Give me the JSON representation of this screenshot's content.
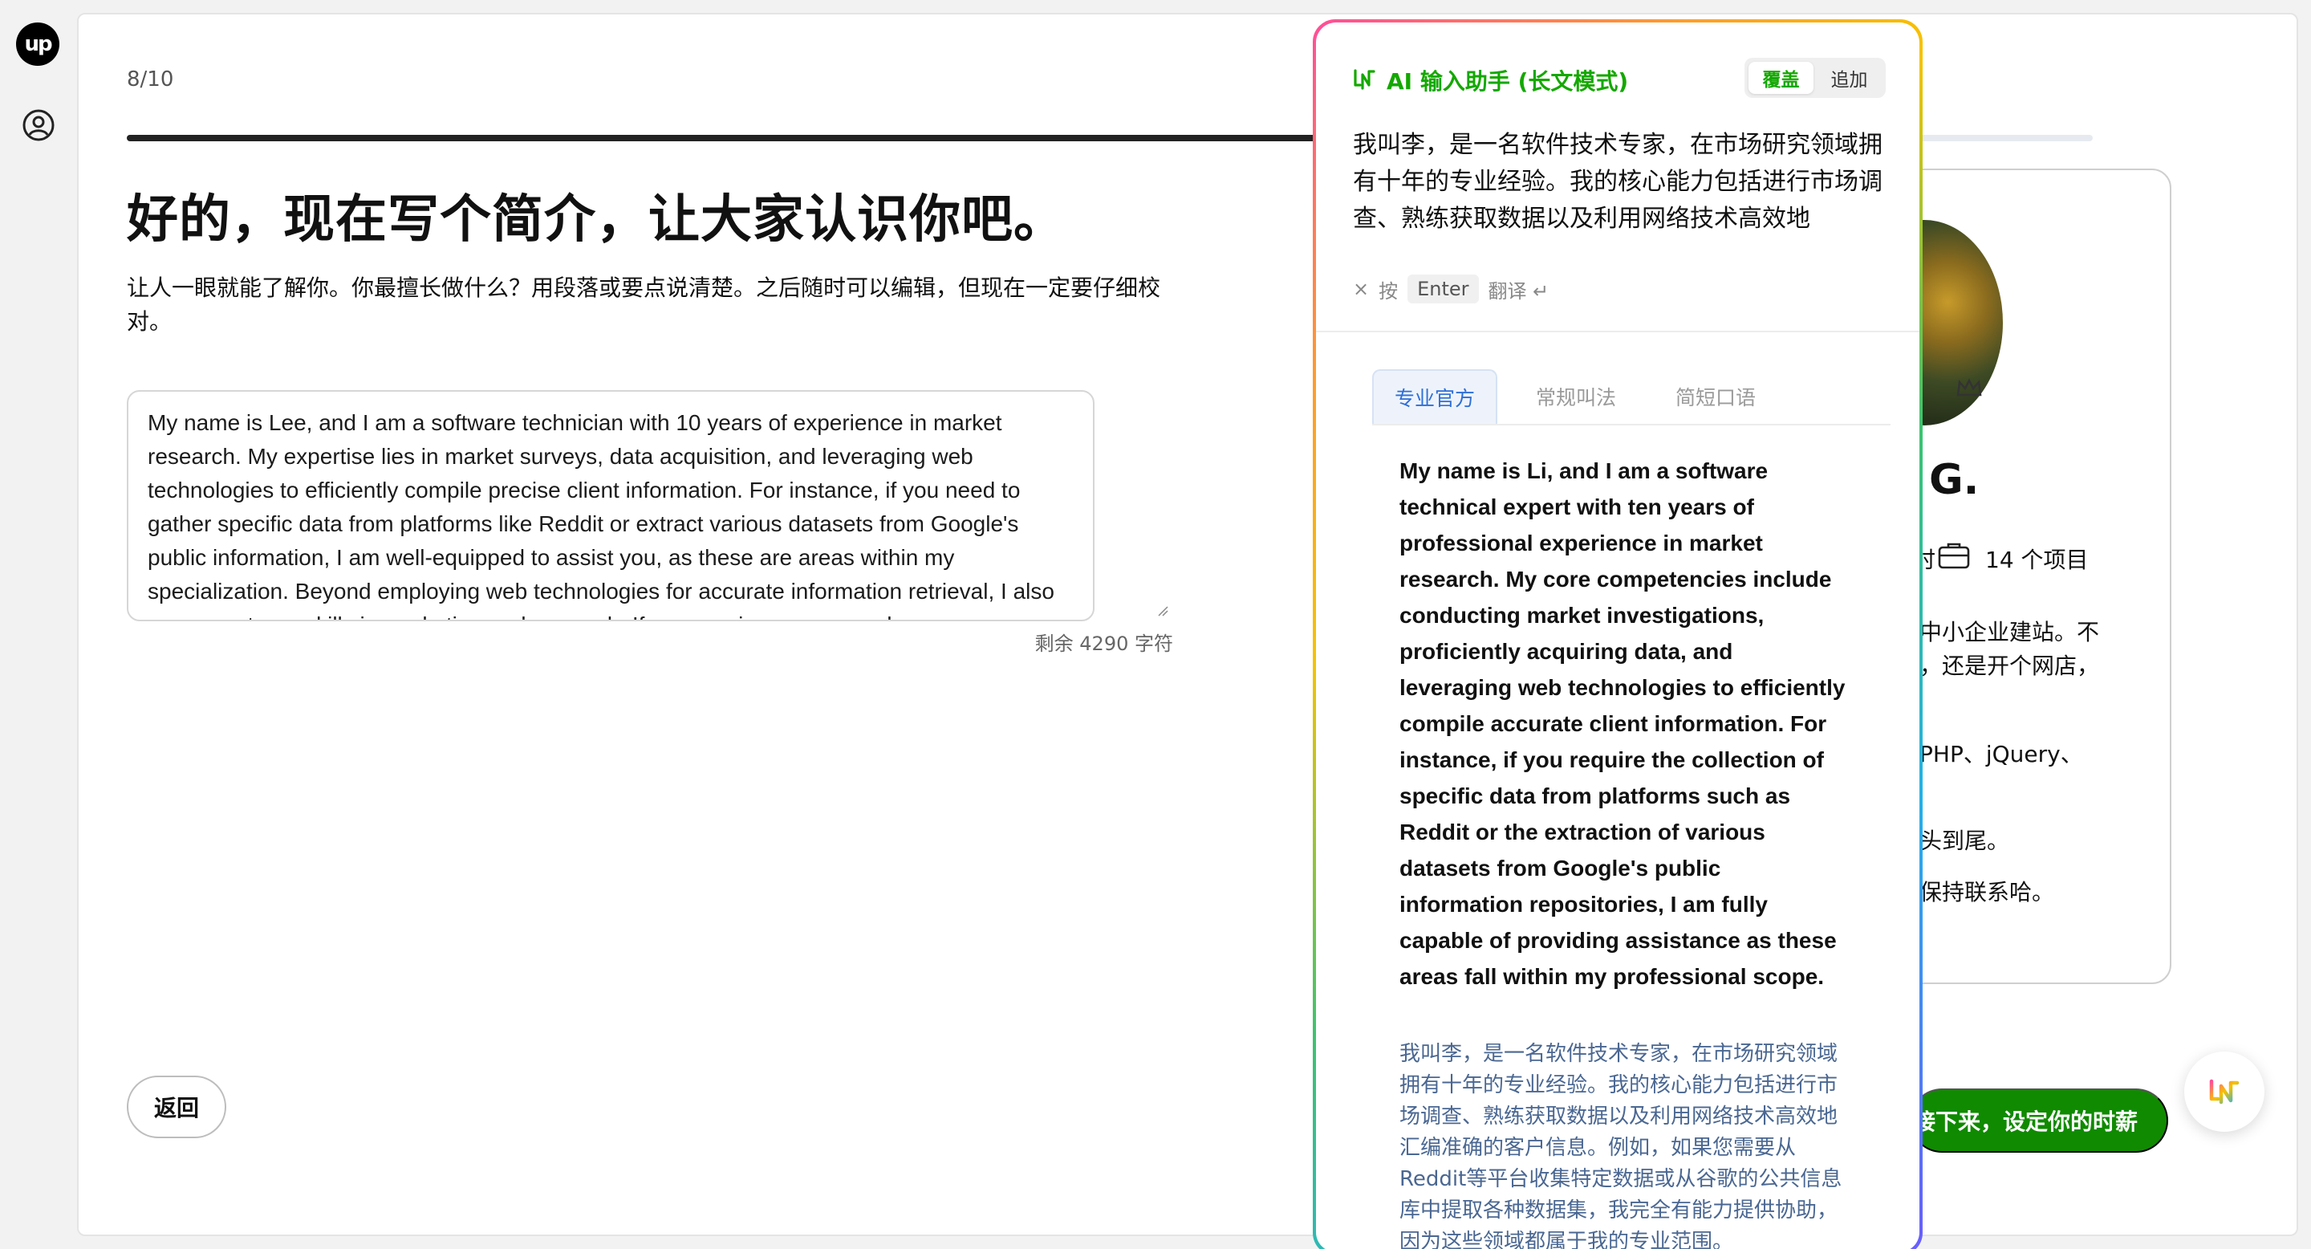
{
  "app": {
    "logo_text": "up"
  },
  "step": {
    "label": "8/10",
    "progress": 0.8
  },
  "page": {
    "heading": "好的，现在写个简介，让大家认识你吧。",
    "subtext": "让人一眼就能了解你。你最擅长做什么？用段落或要点说清楚。之后随时可以编辑，但现在一定要仔细校对。",
    "bio_value": "My name is Lee, and I am a software technician with 10 years of experience in market research. My expertise lies in market surveys, data acquisition, and leveraging web technologies to efficiently compile precise client information. For instance, if you need to gather specific data from platforms like Reddit or extract various datasets from Google's public information, I am well-equipped to assist you, as these are areas within my specialization. Beyond employing web technologies for accurate information retrieval, I also possess strong skills in marketing and research. If you require any research...",
    "char_count": "剩余 4290 字符",
    "back_label": "返回",
    "next_label": "接下来，设定你的时薪"
  },
  "preview": {
    "name": "G.",
    "projects": "14 个项目",
    "line_stub": "时",
    "lines": [
      "中小企业建站。不",
      "，还是开个网店，",
      "PHP、jQuery、",
      "头到尾。",
      "保持联系哈。"
    ]
  },
  "ai_panel": {
    "title": "AI 输入助手 (长文模式)",
    "mode_overwrite": "覆盖",
    "mode_append": "追加",
    "source_text": "我叫李，是一名软件技术专家，在市场研究领域拥有十年的专业经验。我的核心能力包括进行市场调查、熟练获取数据以及利用网络技术高效地",
    "hint_close": "×",
    "hint_press": "按",
    "hint_key": "Enter",
    "hint_translate": "翻译 ↵",
    "tabs": [
      "专业官方",
      "常规叫法",
      "简短口语"
    ],
    "result": "My name is Li, and I am a software technical expert with ten years of professional experience in market research. My core competencies include conducting market investigations, proficiently acquiring data, and leveraging web technologies to efficiently compile accurate client information. For instance, if you require the collection of specific data from platforms such as Reddit or the extraction of various datasets from Google's public information repositories, I am fully capable of providing assistance as these areas fall within my professional scope.",
    "translation": "我叫李，是一名软件技术专家，在市场研究领域拥有十年的专业经验。我的核心能力包括进行市场调查、熟练获取数据以及利用网络技术高效地汇编准确的客户信息。例如，如果您需要从Reddit等平台收集特定数据或从谷歌的公共信息库中提取各种数据集，我完全有能力提供协助，因为这些领域都属于我的专业范围。"
  },
  "colors": {
    "brand_green": "#14a800",
    "button_green": "#108a00",
    "tab_blue": "#2d6fd8"
  },
  "icons": [
    "upwork-logo-icon",
    "user-circle-icon",
    "ai-assistant-icon",
    "briefcase-icon",
    "crown-icon",
    "resize-grip-icon"
  ]
}
